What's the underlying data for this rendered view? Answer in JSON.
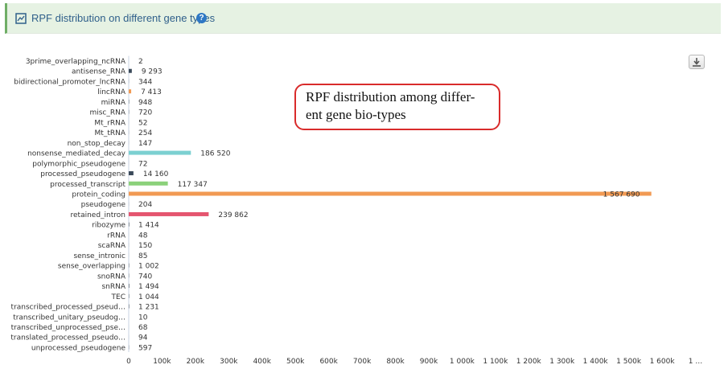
{
  "header": {
    "title": "RPF distribution on different gene types",
    "help_glyph": "?"
  },
  "annotation": {
    "line1": "RPF distribution among differ-",
    "line2": "ent gene bio-types"
  },
  "colors": {
    "accent_green": "#6fae66",
    "header_bg": "#e6f2e3",
    "bar_blue_dark": "#3b4a5a",
    "bar_orange": "#f19a53",
    "bar_teal": "#7cd0d1",
    "bar_green": "#8bd17a",
    "bar_red": "#e5556f",
    "annotation_border": "#d92b2b"
  },
  "chart_data": {
    "type": "bar",
    "orientation": "horizontal",
    "title": "RPF distribution on different gene types",
    "categories": [
      "3prime_overlapping_ncRNA",
      "antisense_RNA",
      "bidirectional_promoter_lncRNA",
      "lincRNA",
      "miRNA",
      "misc_RNA",
      "Mt_rRNA",
      "Mt_tRNA",
      "non_stop_decay",
      "nonsense_mediated_decay",
      "polymorphic_pseudogene",
      "processed_pseudogene",
      "processed_transcript",
      "protein_coding",
      "pseudogene",
      "retained_intron",
      "ribozyme",
      "rRNA",
      "scaRNA",
      "sense_intronic",
      "sense_overlapping",
      "snoRNA",
      "snRNA",
      "TEC",
      "transcribed_processed_pseud…",
      "transcribed_unitary_pseudog…",
      "transcribed_unprocessed_pse…",
      "translated_processed_pseudo…",
      "unprocessed_pseudogene"
    ],
    "values": [
      2,
      9293,
      344,
      7413,
      948,
      720,
      52,
      254,
      147,
      186520,
      72,
      14160,
      117347,
      1567690,
      204,
      239862,
      1414,
      48,
      150,
      85,
      1002,
      740,
      1494,
      1044,
      1231,
      10,
      68,
      94,
      597
    ],
    "value_labels": [
      "2",
      "9 293",
      "344",
      "7 413",
      "948",
      "720",
      "52",
      "254",
      "147",
      "186 520",
      "72",
      "14 160",
      "117 347",
      "1 567 690",
      "204",
      "239 862",
      "1 414",
      "48",
      "150",
      "85",
      "1 002",
      "740",
      "1 494",
      "1 044",
      "1 231",
      "10",
      "68",
      "94",
      "597"
    ],
    "bar_colors": [
      "#3b4a5a",
      "#3b4a5a",
      "#3b4a5a",
      "#f19a53",
      "#3b4a5a",
      "#3b4a5a",
      "#3b4a5a",
      "#3b4a5a",
      "#3b4a5a",
      "#7cd0d1",
      "#3b4a5a",
      "#3b4a5a",
      "#8bd17a",
      "#f19a53",
      "#3b4a5a",
      "#e5556f",
      "#3b4a5a",
      "#3b4a5a",
      "#3b4a5a",
      "#3b4a5a",
      "#3b4a5a",
      "#3b4a5a",
      "#3b4a5a",
      "#3b4a5a",
      "#3b4a5a",
      "#3b4a5a",
      "#3b4a5a",
      "#3b4a5a",
      "#3b4a5a"
    ],
    "xlim": [
      0,
      1700000
    ],
    "x_ticks": [
      "0",
      "100k",
      "200k",
      "300k",
      "400k",
      "500k",
      "600k",
      "700k",
      "800k",
      "900k",
      "1 000k",
      "1 100k",
      "1 200k",
      "1 300k",
      "1 400k",
      "1 500k",
      "1 600k",
      "1 …"
    ],
    "grid": false,
    "legend": "none"
  }
}
